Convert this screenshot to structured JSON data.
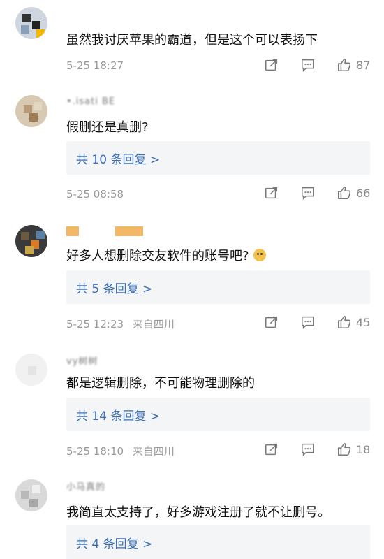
{
  "comments": [
    {
      "username": "",
      "text": "虽然我讨厌苹果的霸道，但是这个可以表扬下",
      "reply_label": "",
      "time": "5-25 18:27",
      "location": "",
      "likes": "87"
    },
    {
      "username": "•.isati  BE",
      "text": "假删还是真删?",
      "reply_label": "共 10 条回复 >",
      "time": "5-25 08:58",
      "location": "",
      "likes": "66"
    },
    {
      "username": "",
      "text": "好多人想删除交友软件的账号吧?",
      "reply_label": "共 5 条回复 >",
      "time": "5-25 12:23",
      "location": "来自四川",
      "likes": "45"
    },
    {
      "username": "vy树树",
      "text": "都是逻辑删除，不可能物理删除的",
      "reply_label": "共 14 条回复 >",
      "time": "5-25 18:10",
      "location": "来自四川",
      "likes": "18"
    },
    {
      "username": "小马真的",
      "text": "我简直太支持了，好多游戏注册了就不让删号。",
      "reply_label": "共 4 条回复 >",
      "time": "",
      "location": "",
      "likes": ""
    }
  ],
  "colors": {
    "link": "#3b6fb6",
    "meta": "#9a9a9a",
    "reply_bg": "#f4f5f7"
  },
  "icons": [
    "share-icon",
    "comment-icon",
    "like-icon",
    "emoji-doge-icon"
  ]
}
